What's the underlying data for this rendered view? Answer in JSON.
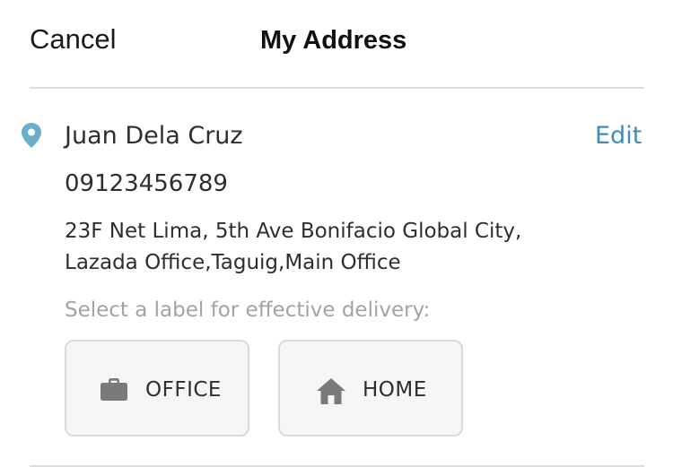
{
  "header": {
    "cancel_label": "Cancel",
    "title": "My Address"
  },
  "address": {
    "name": "Juan Dela Cruz",
    "edit_label": "Edit",
    "phone": "09123456789",
    "line1": "23F Net Lima, 5th Ave Bonifacio Global City,",
    "line2": "Lazada Office,Taguig,Main Office"
  },
  "labels": {
    "hint": "Select a label for effective delivery:",
    "office": {
      "text": "OFFICE",
      "icon": "briefcase-icon"
    },
    "home": {
      "text": "HOME",
      "icon": "home-icon"
    }
  },
  "colors": {
    "accent": "#3d8fb5",
    "pin": "#6aaec9",
    "hint_text": "#a3a3a3",
    "icon_gray": "#7a7a7a",
    "button_border": "#dadada",
    "button_bg": "#f6f6f6"
  }
}
